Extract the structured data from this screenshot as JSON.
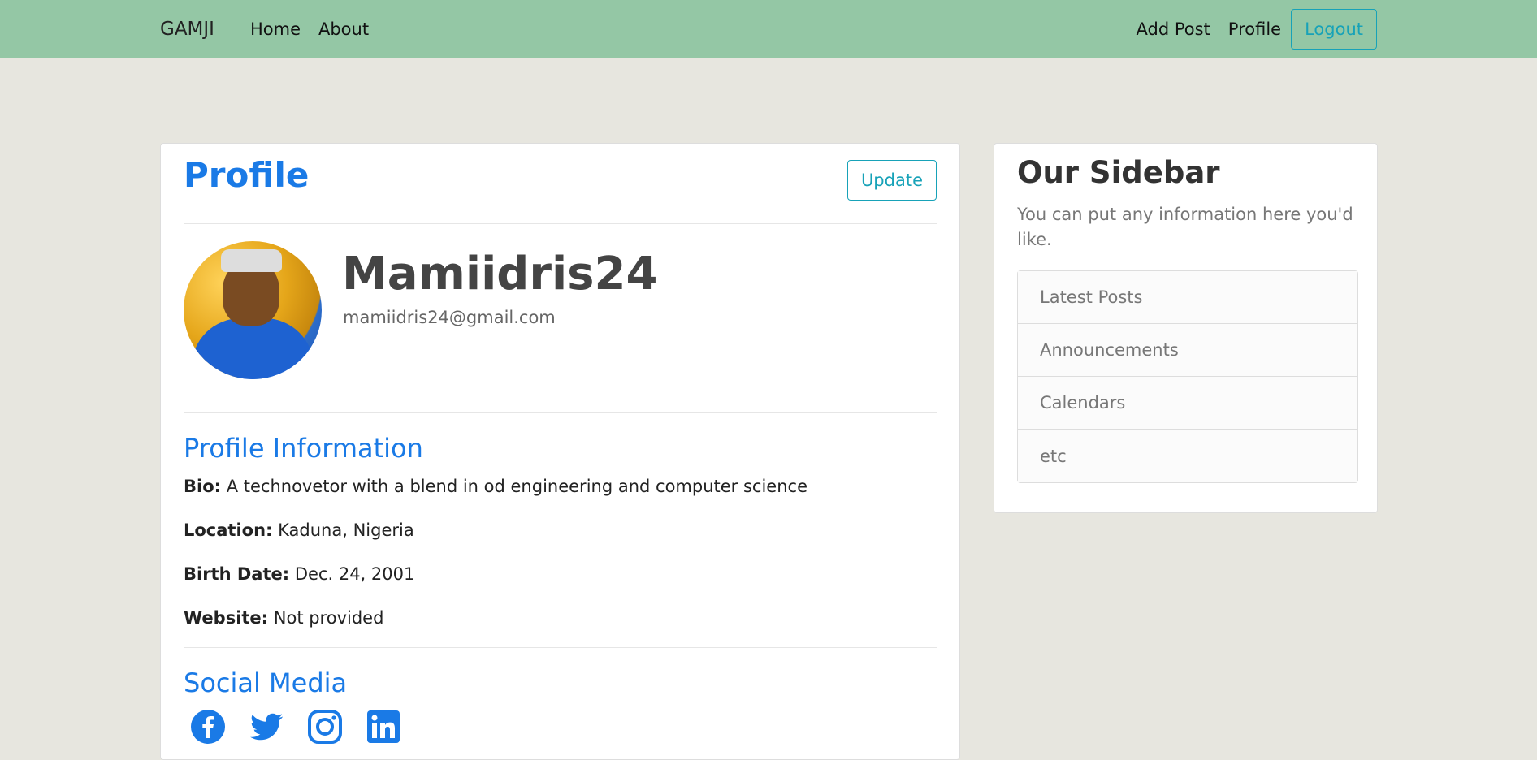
{
  "navbar": {
    "brand": "GAMJI",
    "left_links": [
      "Home",
      "About"
    ],
    "right_links": [
      "Add Post",
      "Profile"
    ],
    "logout_label": "Logout"
  },
  "profile": {
    "title": "Profile",
    "update_label": "Update",
    "username": "Mamiidris24",
    "email": "mamiidris24@gmail.com"
  },
  "info": {
    "title": "Profile Information",
    "bio_label": "Bio:",
    "bio": "A technovetor with a blend in od engineering and computer science",
    "location_label": "Location:",
    "location": "Kaduna, Nigeria",
    "birth_label": "Birth Date:",
    "birth_date": "Dec. 24, 2001",
    "website_label": "Website:",
    "website": "Not provided"
  },
  "social": {
    "title": "Social Media",
    "icons": [
      "facebook-icon",
      "twitter-icon",
      "instagram-icon",
      "linkedin-icon"
    ]
  },
  "sidebar": {
    "title": "Our Sidebar",
    "subtitle": "You can put any information here you'd like.",
    "items": [
      "Latest Posts",
      "Announcements",
      "Calendars",
      "etc"
    ]
  },
  "colors": {
    "navbar_bg": "#94c7a5",
    "page_bg": "#e7e6df",
    "accent_blue": "#1a7ae6",
    "button_teal": "#17a2b8"
  }
}
